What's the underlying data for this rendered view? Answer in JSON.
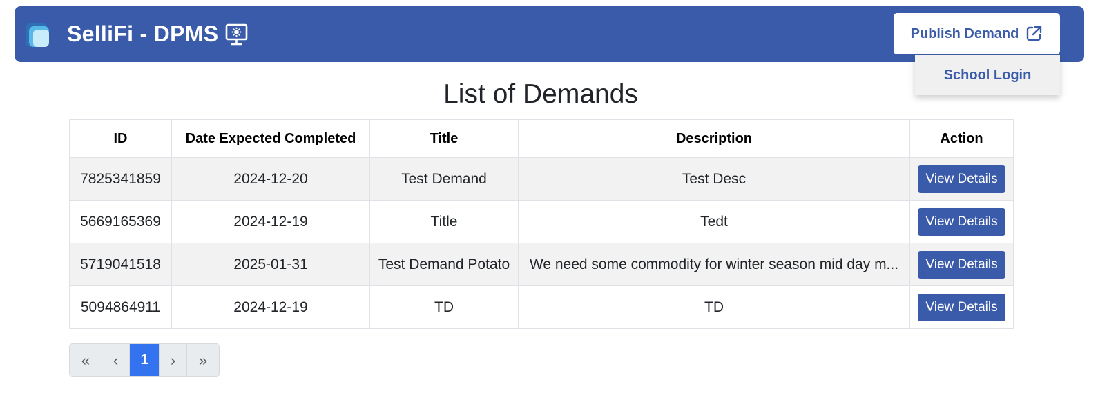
{
  "header": {
    "brand": "SelliFi - DPMS",
    "brand_icon": "computer-settings-icon",
    "publish_label": "Publish Demand",
    "publish_icon": "external-link-icon",
    "accent": "#3a5ba9"
  },
  "dropdown": {
    "school_login_label": "School Login"
  },
  "main": {
    "title": "List of Demands",
    "columns": [
      "ID",
      "Date Expected Completed",
      "Title",
      "Description",
      "Action"
    ],
    "rows": [
      {
        "id": "7825341859",
        "date": "2024-12-20",
        "title": "Test Demand",
        "description": "Test Desc",
        "action": "View Details"
      },
      {
        "id": "5669165369",
        "date": "2024-12-19",
        "title": "Title",
        "description": "Tedt",
        "action": "View Details"
      },
      {
        "id": "5719041518",
        "date": "2025-01-31",
        "title": "Test Demand Potato",
        "description": "We need some commodity for winter season mid day m...",
        "action": "View Details"
      },
      {
        "id": "5094864911",
        "date": "2024-12-19",
        "title": "TD",
        "description": "TD",
        "action": "View Details"
      }
    ]
  },
  "pagination": {
    "first": "«",
    "prev": "‹",
    "current": "1",
    "next": "›",
    "last": "»"
  }
}
